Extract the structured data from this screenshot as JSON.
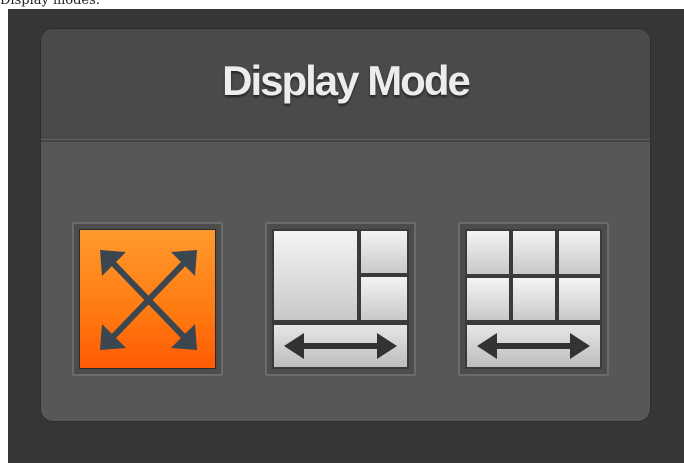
{
  "caption": "Display modes.",
  "panel": {
    "title": "Display Mode"
  },
  "modes": [
    {
      "id": "fullscreen",
      "icon": "fullscreen-arrows-icon",
      "active": true
    },
    {
      "id": "pip",
      "icon": "large-plus-two-small-layout-icon",
      "active": false
    },
    {
      "id": "grid",
      "icon": "six-grid-layout-icon",
      "active": false
    }
  ],
  "colors": {
    "background": "#363636",
    "panel": "#575757",
    "active_accent": "#ff7a10",
    "title_text": "#ececec"
  }
}
